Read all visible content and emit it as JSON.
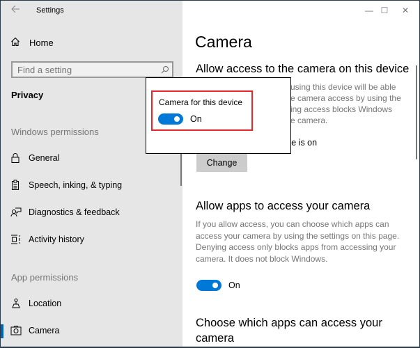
{
  "window": {
    "title": "Settings",
    "controls": {
      "minimize": "—",
      "maximize": "☐",
      "close": "✕"
    }
  },
  "sidebar": {
    "home_label": "Home",
    "search_placeholder": "Find a setting",
    "section_title": "Privacy",
    "groups": [
      {
        "label": "Windows permissions",
        "items": [
          {
            "label": "General",
            "icon": "lock-icon"
          },
          {
            "label": "Speech, inking, & typing",
            "icon": "clipboard-icon"
          },
          {
            "label": "Diagnostics & feedback",
            "icon": "feedback-icon"
          },
          {
            "label": "Activity history",
            "icon": "activity-history-icon"
          }
        ]
      },
      {
        "label": "App permissions",
        "items": [
          {
            "label": "Location",
            "icon": "location-icon"
          },
          {
            "label": "Camera",
            "icon": "camera-icon",
            "active": true
          }
        ]
      }
    ]
  },
  "main": {
    "page_title": "Camera",
    "section1": {
      "heading": "Allow access to the camera on this device",
      "desc_fragments": [
        "using this device will be able",
        "e camera access by using the",
        "ing access blocks Windows",
        "e camera."
      ],
      "status_fragment": "ce is on",
      "change_label": "Change"
    },
    "section2": {
      "heading": "Allow apps to access your camera",
      "desc": "If you allow access, you can choose which apps can access your camera by using the settings on this page. Denying access only blocks apps from accessing your camera. It does not block Windows.",
      "toggle_state": "On"
    },
    "section3": {
      "heading": "Choose which apps can access your camera"
    }
  },
  "popup": {
    "label": "Camera for this device",
    "toggle_state": "On",
    "highlight_color": "#e8262a"
  },
  "colors": {
    "accent": "#0078d7",
    "sidebar_bg": "#e6e6e6"
  }
}
